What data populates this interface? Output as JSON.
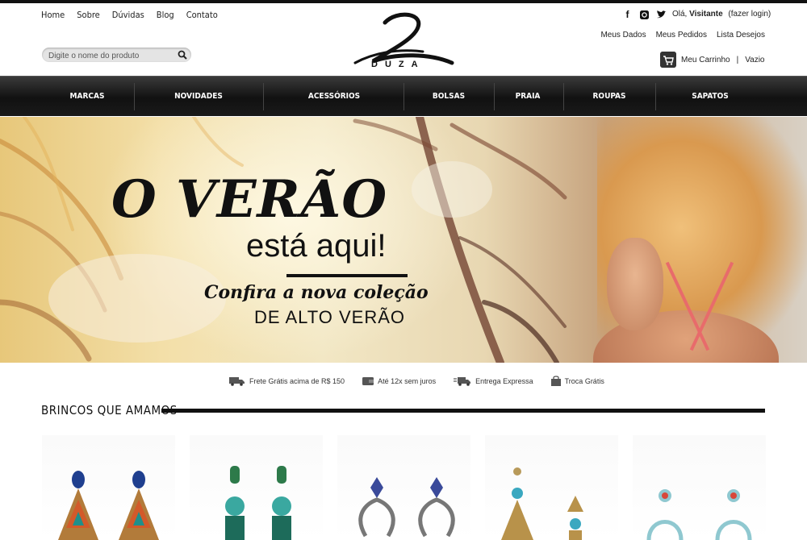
{
  "header": {
    "top_links": [
      "Home",
      "Sobre",
      "Dúvidas",
      "Blog",
      "Contato"
    ],
    "search_placeholder": "Digite o nome do produto",
    "logo_text": "DUZA",
    "greeting_prefix": "Olá,",
    "user_name": "Visitante",
    "login_link": "(fazer login)",
    "account_links": [
      "Meus Dados",
      "Meus Pedidos",
      "Lista Desejos"
    ],
    "cart_label": "Meu Carrinho",
    "cart_separator": "|",
    "cart_status": "Vazio",
    "social_icons": [
      "facebook-icon",
      "instagram-icon",
      "twitter-icon"
    ]
  },
  "nav": {
    "items": [
      "MARCAS",
      "NOVIDADES",
      "ACESSÓRIOS",
      "BOLSAS",
      "PRAIA",
      "ROUPAS",
      "SAPATOS"
    ]
  },
  "banner": {
    "headline": "O VERÃO",
    "line1": "está aqui!",
    "line2": "Confira a nova coleção",
    "line3": "DE ALTO VERÃO"
  },
  "benefits": [
    {
      "icon": "truck-icon",
      "label": "Frete Grátis acima de R$ 150"
    },
    {
      "icon": "wallet-icon",
      "label": "Até 12x sem juros"
    },
    {
      "icon": "fast-truck-icon",
      "label": "Entrega Expressa"
    },
    {
      "icon": "bag-icon",
      "label": "Troca Grátis"
    }
  ],
  "section": {
    "title": "BRINCOS QUE AMAMOS"
  },
  "products": [
    {
      "icon": "triangle-earring-image"
    },
    {
      "icon": "turquoise-earring-image"
    },
    {
      "icon": "hoop-earring-image"
    },
    {
      "icon": "gold-fan-earring-image"
    },
    {
      "icon": "coral-earring-image"
    }
  ],
  "colors": {
    "nav_bg": "#111111",
    "accent": "#111111"
  }
}
